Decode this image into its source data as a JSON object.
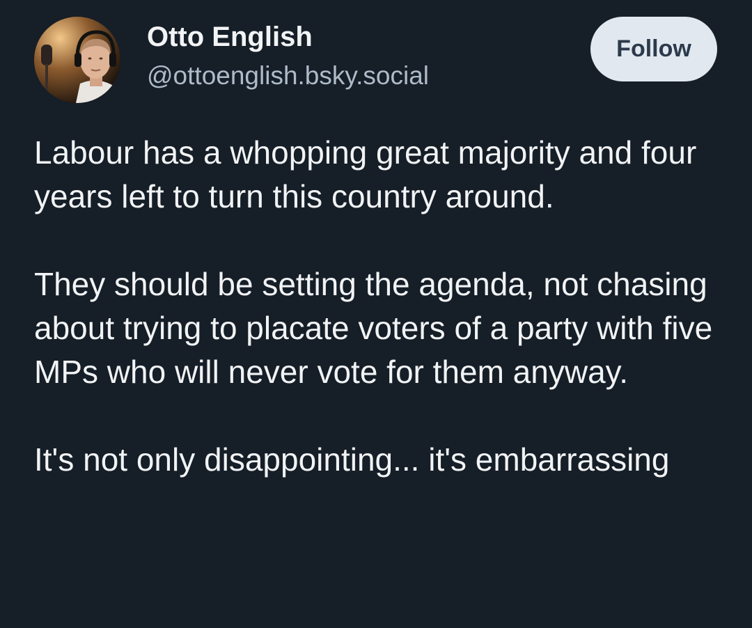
{
  "author": {
    "display_name": "Otto English",
    "handle": "@ottoenglish.bsky.social"
  },
  "follow_label": "Follow",
  "post": {
    "paragraphs": [
      "Labour has a whopping great majority and four years left to turn this country around.",
      "They should be setting the agenda, not chasing about trying to placate voters of a party with five MPs who will never vote for them anyway.",
      "It's not only disappointing... it's embarrassing"
    ]
  },
  "colors": {
    "background": "#161e27",
    "text": "#f1f3f5",
    "handle": "#aebbc9",
    "follow_bg": "#e1e8ef",
    "follow_text": "#2c3a4c"
  }
}
